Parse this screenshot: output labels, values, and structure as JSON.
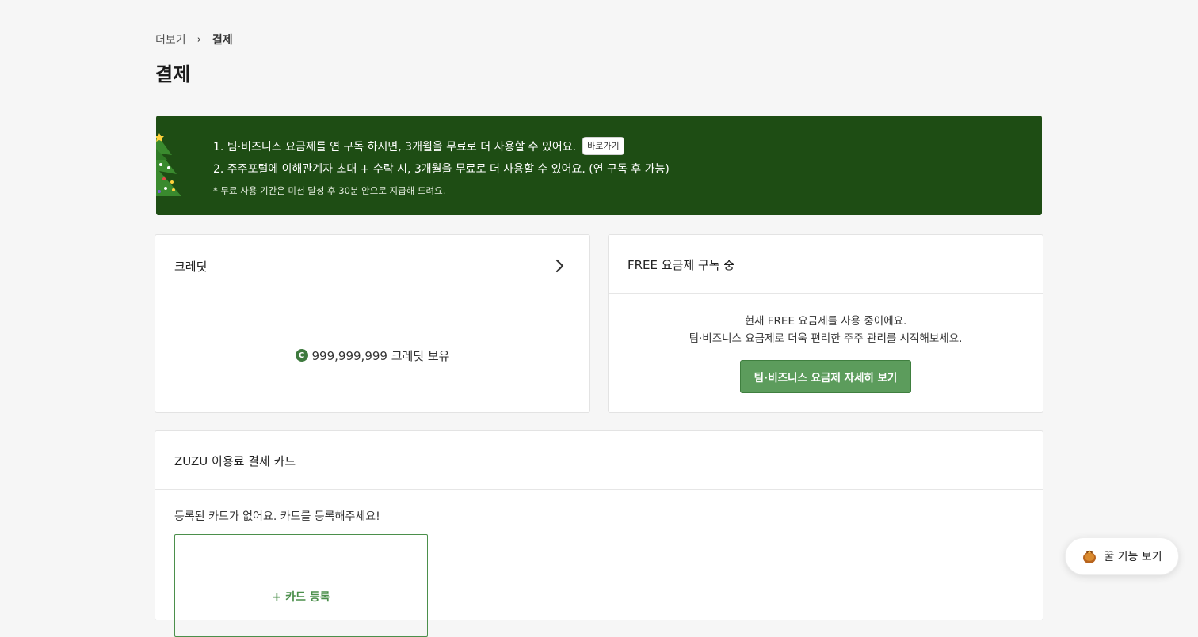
{
  "breadcrumb": {
    "parent": "더보기",
    "current": "결제"
  },
  "page_title": "결제",
  "banner": {
    "line1": "1. 팀·비즈니스 요금제를 연 구독 하시면, 3개월을 무료로 더 사용할 수 있어요.",
    "line1_button": "바로가기",
    "line2": "2. 주주포털에 이해관계자 초대 + 수락 시, 3개월을 무료로 더 사용할 수 있어요. (연 구독 후 가능)",
    "note": "* 무료 사용 기간은 미션 달성 후 30분 안으로 지급해 드려요.",
    "background_color": "#1e4d14"
  },
  "credit": {
    "title": "크레딧",
    "coin_symbol": "C",
    "amount_text": "999,999,999 크레딧 보유"
  },
  "plan": {
    "title": "FREE 요금제 구독 중",
    "line1": "현재 FREE 요금제를 사용 중이에요.",
    "line2": "팀·비즈니스 요금제로 더욱 편리한 주주 관리를 시작해보세요.",
    "button": "팀·비즈니스 요금제 자세히 보기",
    "accent_color": "#5c9c5c"
  },
  "payment": {
    "title": "ZUZU 이용료 결제 카드",
    "empty_message": "등록된 카드가 없어요. 카드를 등록해주세요!",
    "add_card_label": "+ 카드 등록"
  },
  "tips": {
    "label": "꿀 기능 보기",
    "icon": "honey-pot-icon"
  }
}
